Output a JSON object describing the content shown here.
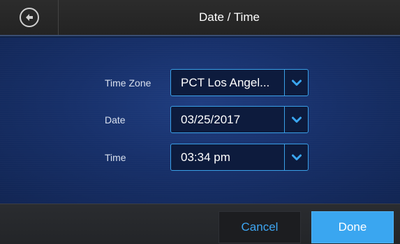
{
  "header": {
    "title": "Date / Time",
    "back_icon": "arrow-left-circle-icon"
  },
  "form": {
    "rows": [
      {
        "label": "Time Zone",
        "value": "PCT Los Angel..."
      },
      {
        "label": "Date",
        "value": "03/25/2017"
      },
      {
        "label": "Time",
        "value": "03:34 pm"
      }
    ],
    "dropdown_icon": "chevron-down-icon"
  },
  "footer": {
    "cancel_label": "Cancel",
    "done_label": "Done"
  },
  "colors": {
    "accent": "#3aa6f0",
    "header_bg": "#2c2c2c",
    "content_bg": "#17306a",
    "field_bg": "#0d1b3d"
  }
}
